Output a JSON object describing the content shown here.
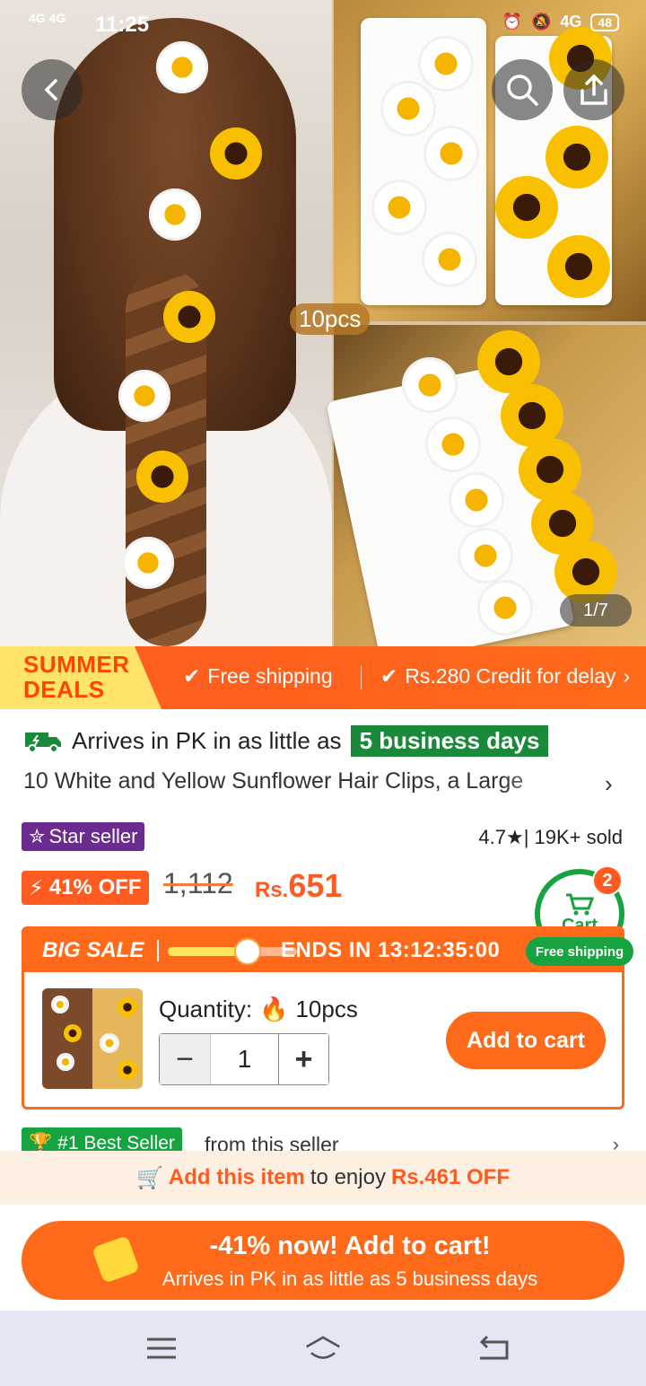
{
  "status_bar": {
    "signal": "4G 4G",
    "time": "11:25",
    "network": "4G",
    "battery": "48"
  },
  "hero": {
    "tag": "10pcs",
    "page_indicator": "1/7"
  },
  "deals_bar": {
    "badge_line1": "SUMMER",
    "badge_line2": "DEALS",
    "free_shipping": "Free shipping",
    "credit": "Rs.280 Credit for delay"
  },
  "delivery": {
    "prefix": "Arrives in PK in as little as",
    "days": "5 business days"
  },
  "product": {
    "title": "10 White and Yellow Sunflower Hair Clips, a Large",
    "seller_badge": "Star seller",
    "rating": "4.7",
    "sold": "| 19K+ sold",
    "discount": "41% OFF",
    "old_price": "1,112",
    "currency": "Rs.",
    "price": "651"
  },
  "cart_widget": {
    "count": "2",
    "label": "Cart",
    "free_shipping": "Free shipping"
  },
  "sale": {
    "label": "BIG SALE",
    "progress": 0.62,
    "ends_label": "ENDS IN",
    "timer": "13:12:35:00",
    "quantity_label": "Quantity:",
    "quantity_option": "10pcs",
    "quantity_value": "1",
    "add_to_cart": "Add to cart"
  },
  "best_seller": {
    "badge": "#1 Best Seller",
    "text": "from this seller"
  },
  "promo": {
    "action": "Add this item",
    "middle": "to enjoy",
    "amount": "Rs.461 OFF"
  },
  "cta": {
    "title": "-41% now! Add to cart!",
    "subtitle": "Arrives in PK in as little as 5 business days"
  },
  "colors": {
    "accent": "#ff6a1a",
    "green": "#17a340",
    "purple": "#6b2b8f"
  }
}
